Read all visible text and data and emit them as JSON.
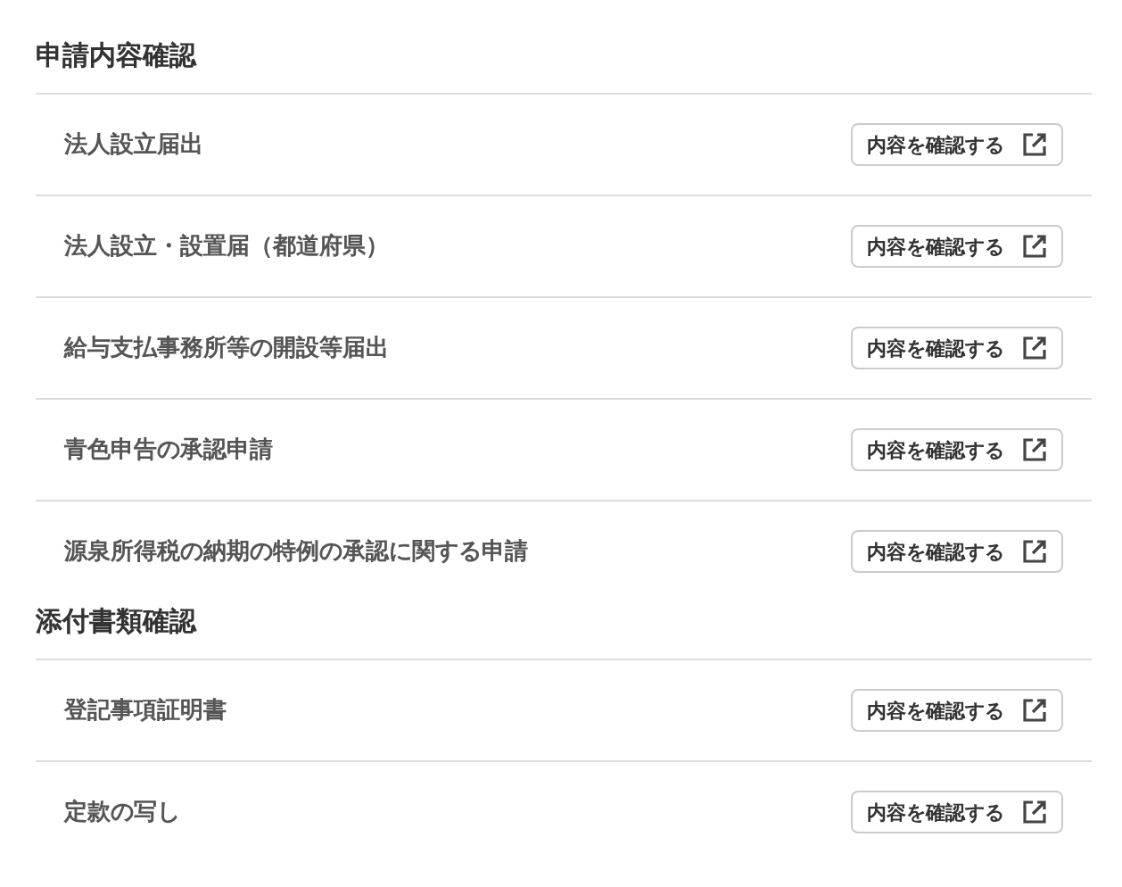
{
  "sections": [
    {
      "title": "申請内容確認",
      "items": [
        {
          "label": "法人設立届出",
          "button": "内容を確認する"
        },
        {
          "label": "法人設立・設置届（都道府県）",
          "button": "内容を確認する"
        },
        {
          "label": "給与支払事務所等の開設等届出",
          "button": "内容を確認する"
        },
        {
          "label": "青色申告の承認申請",
          "button": "内容を確認する"
        },
        {
          "label": "源泉所得税の納期の特例の承認に関する申請",
          "button": "内容を確認する"
        }
      ]
    },
    {
      "title": "添付書類確認",
      "items": [
        {
          "label": "登記事項証明書",
          "button": "内容を確認する"
        },
        {
          "label": "定款の写し",
          "button": "内容を確認する"
        }
      ]
    }
  ]
}
